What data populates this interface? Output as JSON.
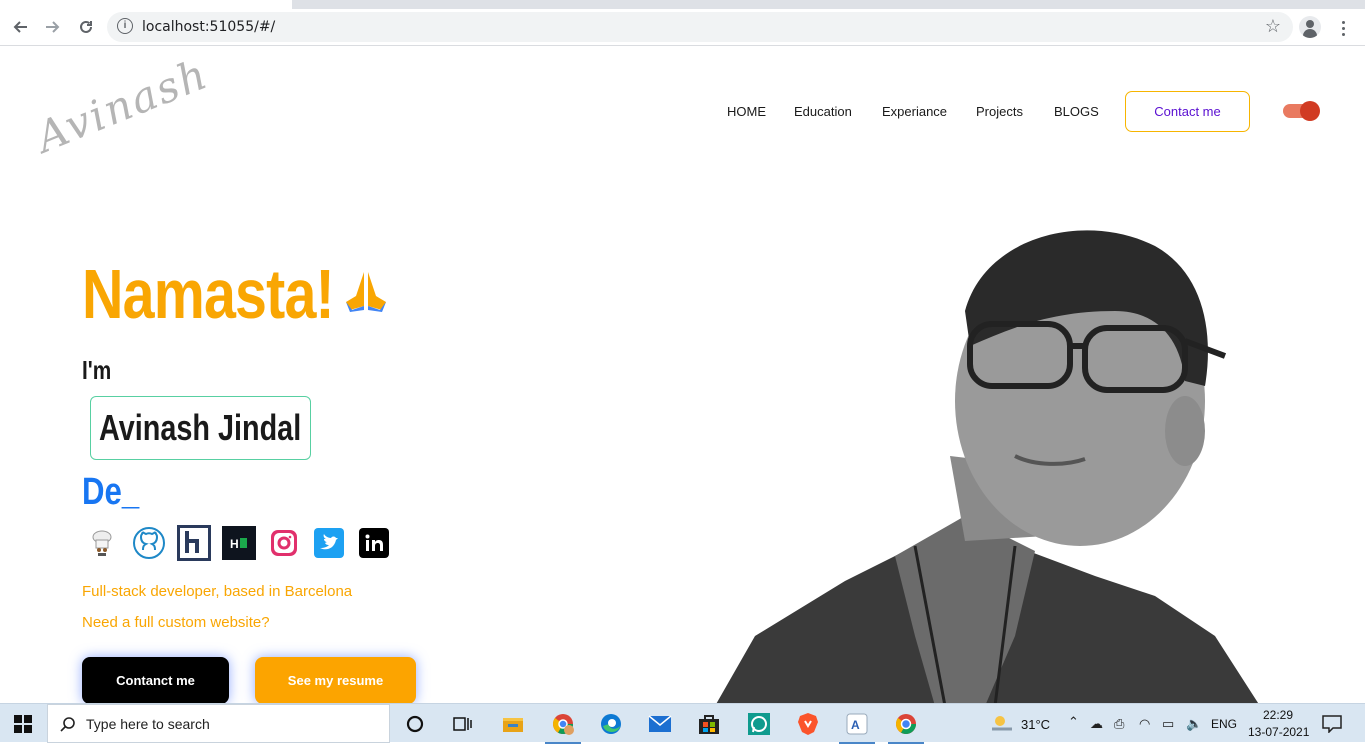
{
  "browser": {
    "url": "localhost:51055/#/"
  },
  "header": {
    "logo_text": "Avinash",
    "nav": [
      "HOME",
      "Education",
      "Experiance",
      "Projects",
      "BLOGS"
    ],
    "contact_label": "Contact me",
    "theme_toggle_on": true
  },
  "hero": {
    "greeting": "Namasta!",
    "greeting_emoji": "folded-hands-icon",
    "im": "I'm",
    "name": "Avinash Jindal",
    "typing_text": "De_",
    "socials": [
      "chef-icon",
      "github-icon",
      "hashnode-icon",
      "hackerrank-icon",
      "instagram-icon",
      "twitter-icon",
      "linkedin-icon"
    ],
    "tagline1": "Full-stack developer, based in Barcelona",
    "tagline2": "Need a full custom website?",
    "btn_contact": "Contanct me",
    "btn_resume": "See my resume"
  },
  "taskbar": {
    "search_placeholder": "Type here to search",
    "weather": "31°C",
    "language": "ENG",
    "time": "22:29",
    "date": "13-07-2021",
    "apps": [
      "cortana-icon",
      "task-view-icon",
      "file-explorer-icon",
      "chrome-profile-icon",
      "edge-icon",
      "mail-icon",
      "store-icon",
      "whatsapp-icon",
      "brave-icon",
      "app-icon",
      "chrome-icon"
    ]
  },
  "colors": {
    "accent_orange": "#f9a603",
    "accent_blue": "#1876f2",
    "contact_border": "#f7b500",
    "contact_text": "#5a0fd1",
    "name_border": "#58d0a2"
  }
}
